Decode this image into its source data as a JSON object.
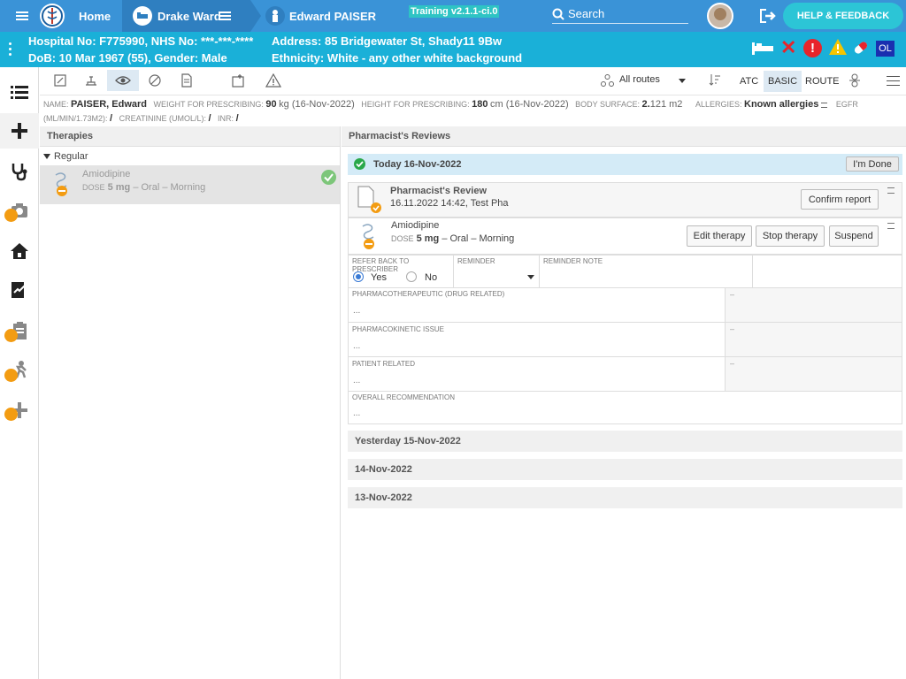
{
  "topbar": {
    "home_label": "Home",
    "ward_label": "Drake Ward",
    "patient_label": "Edward PAISER",
    "version": "Training v2.1.1-ci.0",
    "search_placeholder": "Search",
    "help_label": "HELP & FEEDBACK"
  },
  "patient": {
    "hospital_line": "Hospital No: F775990, NHS No: ***-***-****",
    "dob_line": "DoB: 10 Mar 1967 (55), Gender: Male",
    "address_line": "Address: 85 Bridgewater St, Shady11 9Bw",
    "ethnicity_line": "Ethnicity: White - any other white background",
    "badge_ol": "OL"
  },
  "toolbar": {
    "routes_label": "All routes",
    "atc_label": "ATC",
    "basic_label": "BASIC",
    "route_label": "ROUTE"
  },
  "info": {
    "name_label": "NAME:",
    "name_value": "PAISER, Edward",
    "weight_label": "WEIGHT FOR PRESCRIBING:",
    "weight_value": "90",
    "weight_unit": "kg (16-Nov-2022)",
    "height_label": "HEIGHT FOR PRESCRIBING:",
    "height_value": "180",
    "height_unit": "cm (16-Nov-2022)",
    "bsa_label": "BODY SURFACE:",
    "bsa_value": "2.",
    "bsa_rest": "121 m2",
    "allergies_label": "ALLERGIES:",
    "allergies_value": "Known allergies",
    "egfr_label": "EGFR",
    "egfr_unit": "(ML/MIN/1.73M2):",
    "egfr_value": "/",
    "creat_label": "CREATININE (UMOL/L):",
    "creat_value": "/",
    "inr_label": "INR:",
    "inr_value": "/"
  },
  "therapies": {
    "title": "Therapies",
    "group": "Regular",
    "items": [
      {
        "name": "Amiodipine",
        "dose_label": "DOSE",
        "dose": "5 mg",
        "route": "– Oral – Morning"
      }
    ]
  },
  "reviews": {
    "title": "Pharmacist's Reviews",
    "today_label": "Today 16-Nov-2022",
    "done_label": "I'm Done",
    "review_title": "Pharmacist's Review",
    "review_meta": "16.11.2022 14:42, Test Pha",
    "confirm_label": "Confirm report",
    "drug_name": "Amiodipine",
    "drug_dose_label": "DOSE",
    "drug_dose": "5 mg",
    "drug_route": "– Oral – Morning",
    "edit_label": "Edit therapy",
    "stop_label": "Stop therapy",
    "suspend_label": "Suspend",
    "refer_label": "REFER BACK TO PRESCRIBER",
    "yes_label": "Yes",
    "no_label": "No",
    "reminder_label": "REMINDER",
    "reminder_note_label": "REMINDER NOTE",
    "pharmaco_label": "PHARMACOTHERAPEUTIC (DRUG RELATED)",
    "pharmaco_value": "...",
    "kinetic_label": "PHARMACOKINETIC ISSUE",
    "kinetic_value": "...",
    "patient_label": "PATIENT RELATED",
    "patient_value": "...",
    "overall_label": "OVERALL RECOMMENDATION",
    "overall_value": "...",
    "dash": "–",
    "dates": [
      "Yesterday 15-Nov-2022",
      "14-Nov-2022",
      "13-Nov-2022"
    ]
  }
}
